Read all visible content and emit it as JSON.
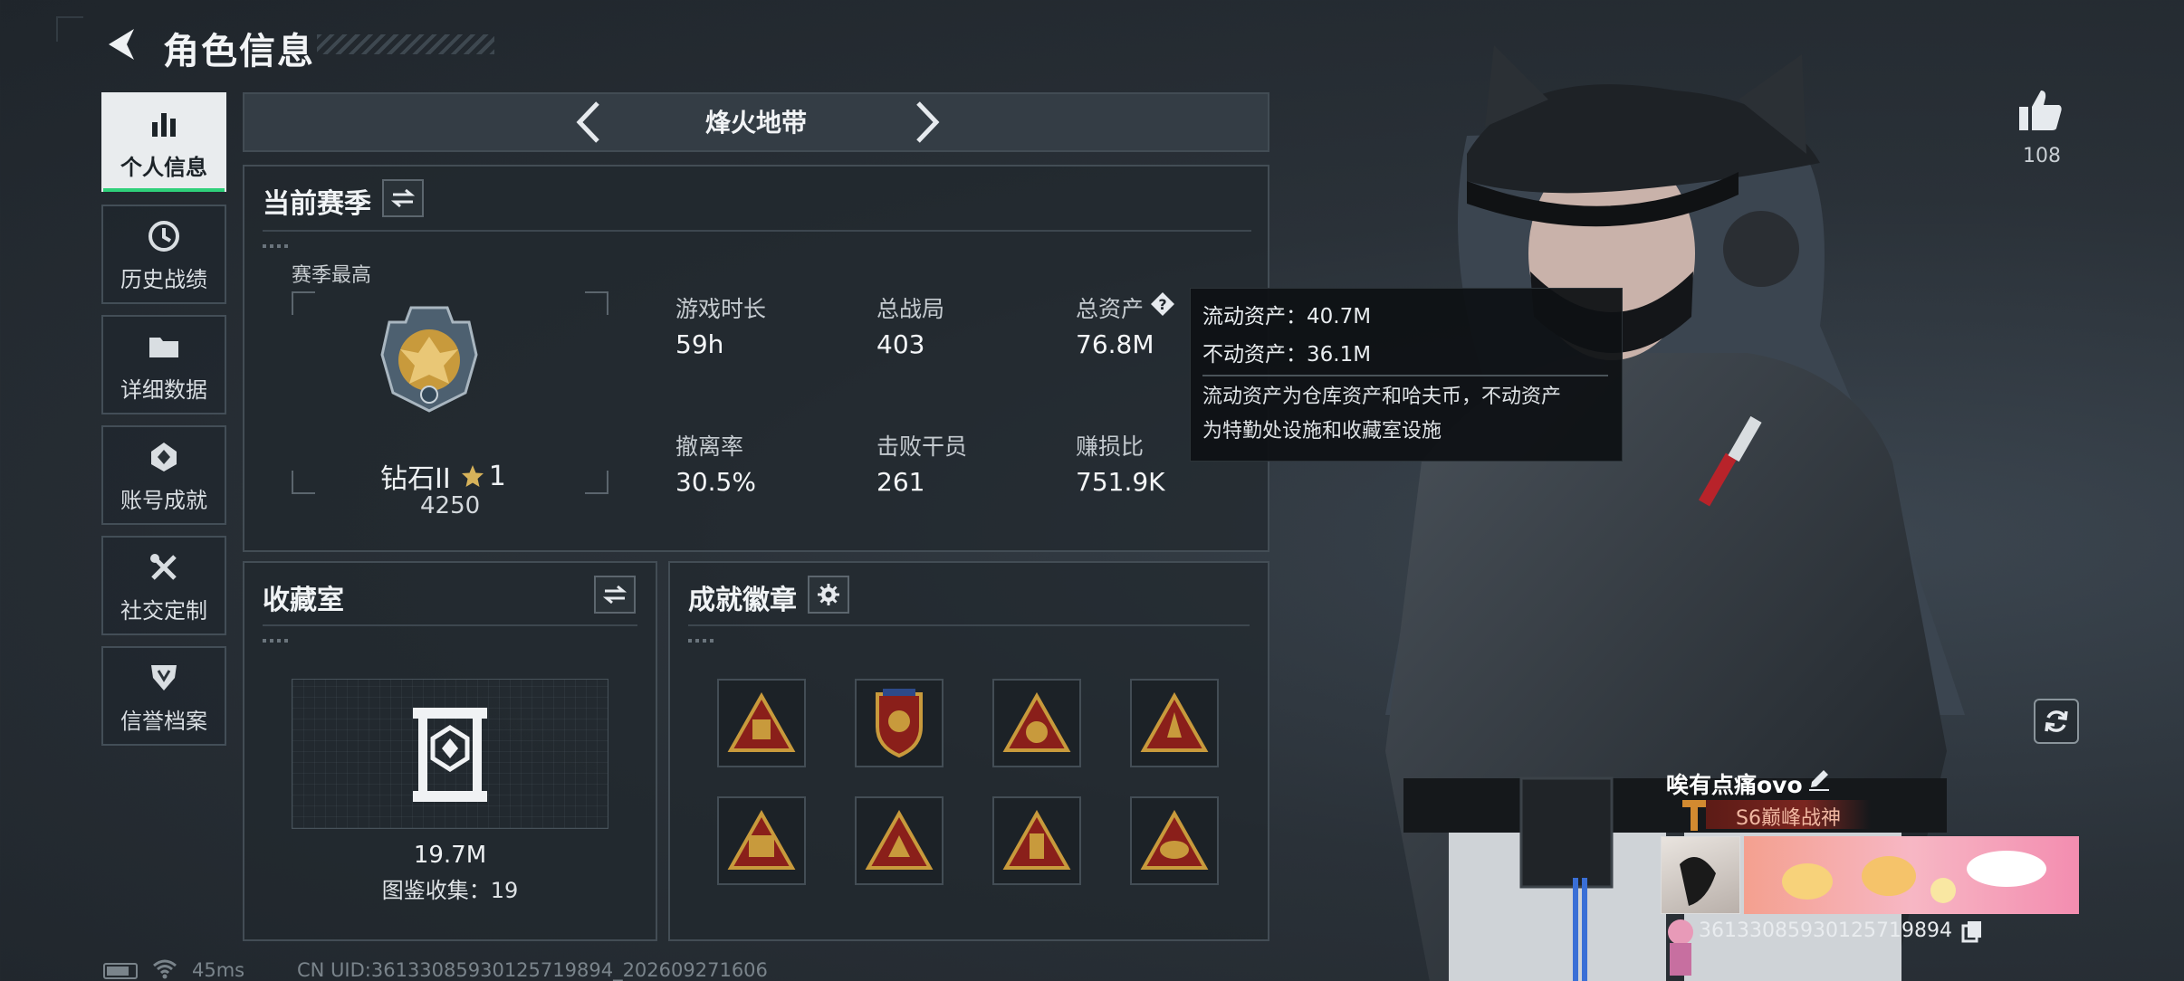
{
  "header": {
    "title": "角色信息"
  },
  "nav": {
    "items": [
      {
        "label": "个人信息",
        "icon": "bar-chart-icon",
        "active": true
      },
      {
        "label": "历史战绩",
        "icon": "clock-icon",
        "active": false
      },
      {
        "label": "详细数据",
        "icon": "folder-icon",
        "active": false
      },
      {
        "label": "账号成就",
        "icon": "achievement-icon",
        "active": false
      },
      {
        "label": "社交定制",
        "icon": "tools-icon",
        "active": false
      },
      {
        "label": "信誉档案",
        "icon": "shield-icon",
        "active": false
      }
    ]
  },
  "mode": {
    "title": "烽火地带"
  },
  "season": {
    "title": "当前赛季",
    "best_label": "赛季最高",
    "rank_name": "钻石II",
    "rank_stars": "1",
    "rank_score": "4250",
    "stats": [
      {
        "label": "游戏时长",
        "value": "59h"
      },
      {
        "label": "总战局",
        "value": "403"
      },
      {
        "label": "总资产",
        "value": "76.8M"
      },
      {
        "label": "撤离率",
        "value": "30.5%"
      },
      {
        "label": "击败干员",
        "value": "261"
      },
      {
        "label": "赚损比",
        "value": "751.9K"
      }
    ]
  },
  "tooltip": {
    "liquid": "流动资产：40.7M",
    "fixed": "不动资产：36.1M",
    "desc_1": "流动资产为仓库资产和哈夫币，不动资产",
    "desc_2": "为特勤处设施和收藏室设施"
  },
  "collection": {
    "title": "收藏室",
    "value": "19.7M",
    "count_label": "图鉴收集：19"
  },
  "achievements": {
    "title": "成就徽章",
    "badge_count": 8
  },
  "profile": {
    "likes": "108",
    "player_name": "唉有点痛ovo",
    "title_text": "S6巅峰战神",
    "uid_short": "3613308593012571989​4"
  },
  "status": {
    "ping": "45ms",
    "uid_line": "CN UID:36133085930125719894_202609271606"
  },
  "colors": {
    "accent_green": "#2fd07a",
    "gold": "#c89a3c",
    "badge_red": "#8a1f1a"
  }
}
